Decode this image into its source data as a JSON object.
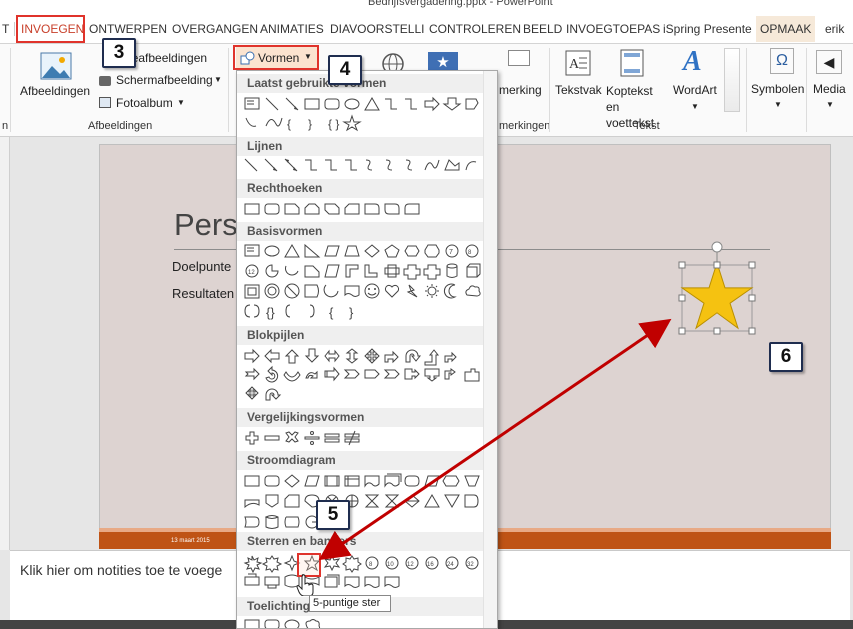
{
  "window": {
    "title": "Bedrijfsvergadering.pptx - PowerPoint"
  },
  "tabs": [
    {
      "label": "T"
    },
    {
      "label": "INVOEGEN"
    },
    {
      "label": "ONTWERPEN"
    },
    {
      "label": "OVERGANGEN"
    },
    {
      "label": "ANIMATIES"
    },
    {
      "label": "DIAVOORSTELLI"
    },
    {
      "label": "CONTROLEREN"
    },
    {
      "label": "BEELD"
    },
    {
      "label": "INVOEGTOEPAS"
    },
    {
      "label": "iSpring Presente"
    },
    {
      "label": "OPMAAK"
    },
    {
      "label": "erik"
    }
  ],
  "ribbon": {
    "afbeeldingen": "Afbeeldingen",
    "onlineafbeeldingen": "neafbeeldingen",
    "schermafbeelding": "Schermafbeelding",
    "fotoalbum": "Fotoalbum",
    "group_afbeeldingen": "Afbeeldingen",
    "vormen": "Vormen",
    "markering": "merking",
    "group_opmerkingen": "merkingen",
    "tekstvak": "Tekstvak",
    "koptekst": "Koptekst en voettekst",
    "wordart": "WordArt",
    "group_tekst": "Tekst",
    "symbolen": "Symbolen",
    "media": "Media",
    "group_left": "n"
  },
  "gallery": {
    "categories": [
      "Laatst gebruikte vormen",
      "Lijnen",
      "Rechthoeken",
      "Basisvormen",
      "Blokpijlen",
      "Vergelijkingsvormen",
      "Stroomdiagram",
      "Sterren en banners",
      "Toelichting"
    ],
    "tooltip": "5-puntige ster"
  },
  "slide": {
    "title": "Perso",
    "bullet1": "Doelpunte",
    "bullet2": "Resultaten",
    "footer_date": "13 maart 2015"
  },
  "notes": {
    "placeholder": "Klik hier om notities toe te voege"
  },
  "callouts": [
    "3",
    "4",
    "5",
    "6"
  ],
  "colors": {
    "accent": "#c8402b",
    "star": "#f5c211",
    "footer": "#bf5315",
    "arrow": "#c00000"
  }
}
